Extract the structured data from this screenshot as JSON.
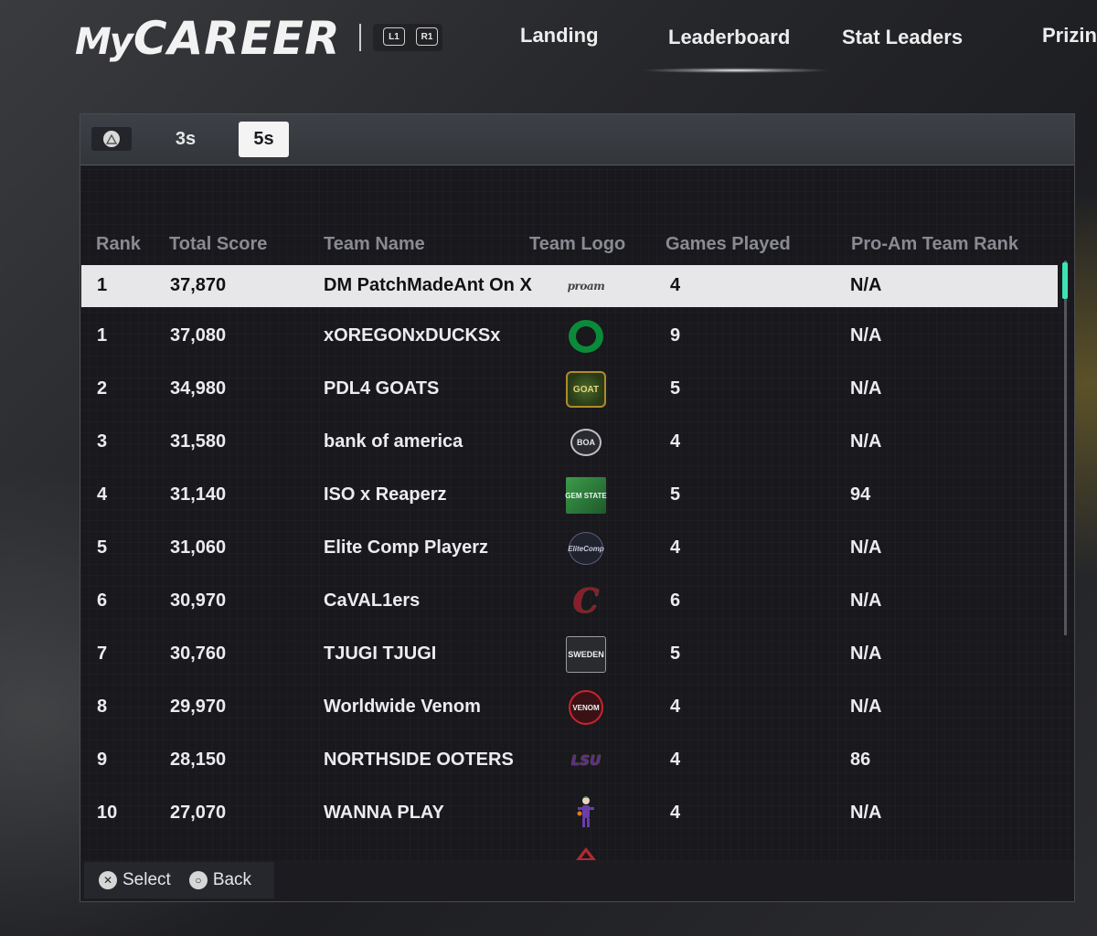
{
  "header": {
    "logo_prefix": "My",
    "logo_main": "CAREER",
    "bumper_left": "L1",
    "bumper_right": "R1",
    "nav_tabs": [
      "Landing",
      "Leaderboard",
      "Stat Leaders",
      "Prizing"
    ],
    "active_tab": "Leaderboard"
  },
  "mode_tabs": {
    "tab_3s": "3s",
    "tab_5s": "5s",
    "active": "5s"
  },
  "table": {
    "columns": [
      "Rank",
      "Total Score",
      "Team Name",
      "Team Logo",
      "Games Played",
      "Pro-Am Team Rank"
    ],
    "rows": [
      {
        "rank": "1",
        "score": "37,870",
        "team": "DM PatchMadeAnt On X",
        "logo": "proam-logo",
        "games": "4",
        "pro_rank": "N/A"
      },
      {
        "rank": "1",
        "score": "37,080",
        "team": "xOREGONxDUCKSx",
        "logo": "oregon-o-logo",
        "games": "9",
        "pro_rank": "N/A"
      },
      {
        "rank": "2",
        "score": "34,980",
        "team": "PDL4 GOATS",
        "logo": "goat-logo",
        "games": "5",
        "pro_rank": "N/A"
      },
      {
        "rank": "3",
        "score": "31,580",
        "team": "bank of america",
        "logo": "boa-logo",
        "games": "4",
        "pro_rank": "N/A"
      },
      {
        "rank": "4",
        "score": "31,140",
        "team": "ISO x Reaperz",
        "logo": "gem-state-logo",
        "games": "5",
        "pro_rank": "94"
      },
      {
        "rank": "5",
        "score": "31,060",
        "team": "Elite Comp Playerz",
        "logo": "elite-comp-logo",
        "games": "4",
        "pro_rank": "N/A"
      },
      {
        "rank": "6",
        "score": "30,970",
        "team": "CaVAL1ers",
        "logo": "cavaliers-c-logo",
        "games": "6",
        "pro_rank": "N/A"
      },
      {
        "rank": "7",
        "score": "30,760",
        "team": "TJUGI TJUGI",
        "logo": "sweden-logo",
        "games": "5",
        "pro_rank": "N/A"
      },
      {
        "rank": "8",
        "score": "29,970",
        "team": "Worldwide Venom",
        "logo": "venom-logo",
        "games": "4",
        "pro_rank": "N/A"
      },
      {
        "rank": "9",
        "score": "28,150",
        "team": "NORTHSIDE OOTERS",
        "logo": "lsu-logo",
        "games": "4",
        "pro_rank": "86"
      },
      {
        "rank": "10",
        "score": "27,070",
        "team": "WANNA PLAY",
        "logo": "joker-logo",
        "games": "4",
        "pro_rank": "N/A"
      }
    ]
  },
  "logo_text": {
    "proam": "proam",
    "oregon": "O",
    "goat": "GOAT",
    "boa": "BOA",
    "gem": "GEM STATE",
    "elite": "EliteComp",
    "cavs": "C",
    "sweden": "SWEDEN",
    "venom": "VENOM",
    "lsu": "LSU"
  },
  "footer": {
    "select_label": "Select",
    "back_label": "Back"
  },
  "colors": {
    "accent_scroll": "#3fe2b5",
    "selected_row": "#e7e7e9"
  }
}
